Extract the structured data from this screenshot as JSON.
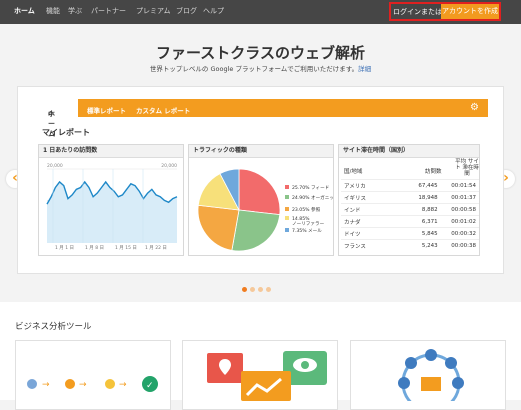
{
  "nav": {
    "items": [
      "ホーム",
      "機能",
      "学ぶ",
      "パートナー",
      "プレミアム",
      "ブログ",
      "ヘルプ"
    ],
    "login_text": "ログインまたは",
    "create_label": "アカウントを作成"
  },
  "hero": {
    "title": "ファーストクラスのウェブ解析",
    "subtitle": "世界トップレベルの Google プラットフォームでご利用いただけます。",
    "detail_link": "詳細"
  },
  "ga": {
    "tabs": [
      "ホーム",
      "標準レポート",
      "カスタム レポート"
    ],
    "myreport": "マイレポート"
  },
  "panels": {
    "visits": {
      "title": "1 日あたりの訪問数"
    },
    "traffic": {
      "title": "トラフィックの種類"
    },
    "dwell": {
      "title": "サイト滞在時間（国別）"
    }
  },
  "chart_data": [
    {
      "type": "line",
      "title": "1 日あたりの訪問数",
      "yticks": [
        "20,000",
        "10,000"
      ],
      "xticks": [
        "1 月 1 日",
        "1 月 8 日",
        "1 月 15 日",
        "1 月 22 日"
      ],
      "ylim": [
        0,
        20000
      ],
      "values": [
        10500,
        12500,
        15000,
        16500,
        15500,
        12000,
        13000,
        14500,
        15000,
        16500,
        15000,
        12500,
        13500,
        15000,
        16500,
        15000,
        14000,
        12500,
        13000,
        14500,
        16000,
        15500,
        14000,
        12000,
        13500,
        14500,
        13000,
        12500,
        11500,
        11000,
        12000,
        12500
      ]
    },
    {
      "type": "pie",
      "title": "トラフィックの種類",
      "series": [
        {
          "name": "フィード",
          "value": 25.7,
          "color": "#f26b6b"
        },
        {
          "name": "オーガニック",
          "value": 24.9,
          "color": "#8ac48a"
        },
        {
          "name": "参照",
          "value": 23.05,
          "color": "#f4a742"
        },
        {
          "name": "ノーリファラー",
          "value": 14.85,
          "color": "#f7e07a"
        },
        {
          "name": "メール",
          "value": 7.35,
          "color": "#6fa8dc"
        }
      ],
      "labels": [
        "25.70% フィード",
        "24.90% オーガニック",
        "23.05% 参照",
        "14.85% ノーリファラー",
        "7.35% メール"
      ]
    },
    {
      "type": "table",
      "title": "サイト滞在時間（国別）",
      "columns": [
        "国/地域",
        "訪問数",
        "平均 サイト 滞在時間"
      ],
      "rows": [
        [
          "アメリカ",
          "67,445",
          "00:01:54"
        ],
        [
          "イギリス",
          "18,948",
          "00:01:37"
        ],
        [
          "インド",
          "8,882",
          "00:00:58"
        ],
        [
          "カナダ",
          "6,371",
          "00:01:02"
        ],
        [
          "ドイツ",
          "5,845",
          "00:00:32"
        ],
        [
          "フランス",
          "5,243",
          "00:00:38"
        ]
      ]
    }
  ],
  "carousel": {
    "prev": "‹",
    "next": "›",
    "slides": 4,
    "active": 0
  },
  "tools": {
    "title": "ビジネス分析ツール"
  },
  "colors": {
    "accent": "#f39c1f",
    "nav_bg": "#464646",
    "highlight": "#e02020"
  }
}
